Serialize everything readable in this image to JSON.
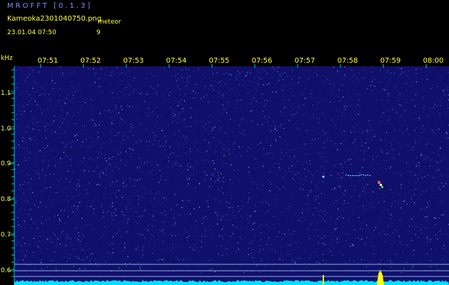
{
  "header": {
    "app_title": "MROFFT [0.1.3]",
    "filename": "Kameoka2301040750.png",
    "date": "23.01.04 07:50",
    "meteor_label": "meteor",
    "meteor_count": "9"
  },
  "axis": {
    "y_unit": "kHz",
    "time_ticks": [
      "07:51",
      "07:52",
      "07:53",
      "07:54",
      "07:55",
      "07:56",
      "07:57",
      "07:58",
      "07:59",
      "08:00"
    ],
    "freq_ticks": [
      "1.1",
      "1.0",
      "0.9",
      "0.8",
      "0.7",
      "0.6"
    ]
  },
  "colors": {
    "text": "#ffff40",
    "title": "#8a8aff",
    "background": "#000000",
    "spectrogram": "#10106a",
    "axis_line": "#00cccc",
    "baseline": "#00e0ff",
    "meteor": "#ffff00"
  }
}
